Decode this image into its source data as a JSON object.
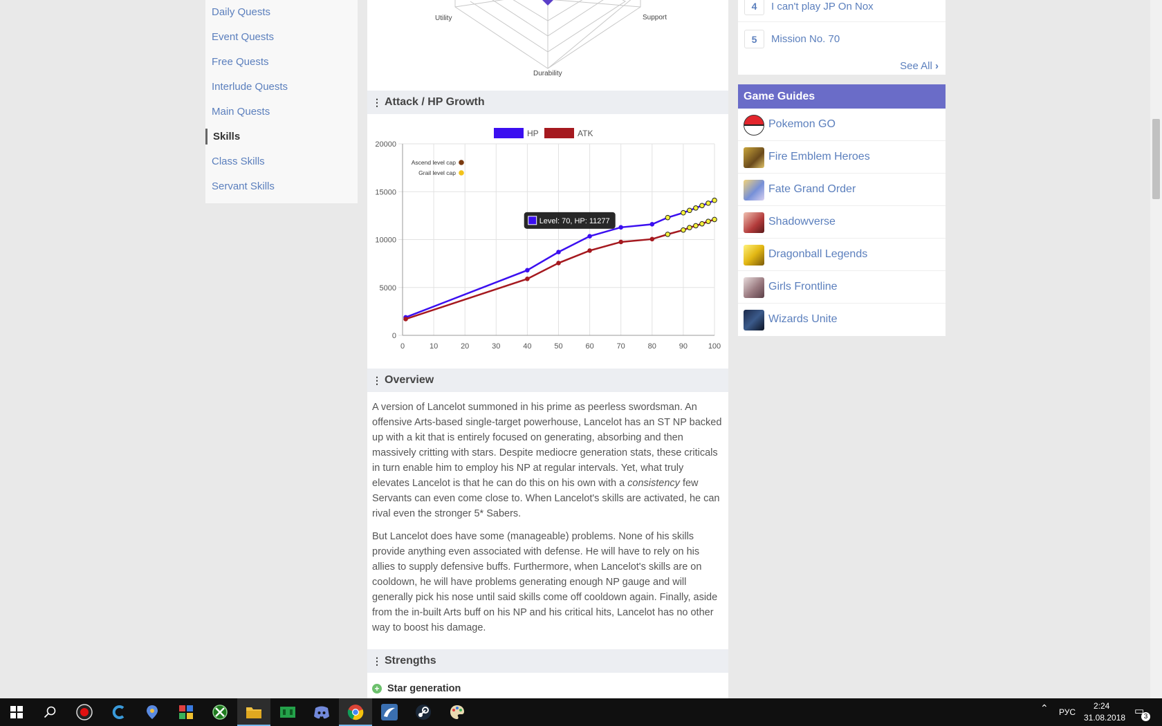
{
  "leftnav": {
    "items": [
      "Daily Quests",
      "Event Quests",
      "Free Quests",
      "Interlude Quests",
      "Main Quests",
      "Skills",
      "Class Skills",
      "Servant Skills"
    ],
    "active": "Skills"
  },
  "radar": {
    "labels": {
      "left": "Utility",
      "right": "Support",
      "bottom": "Durability"
    }
  },
  "growth": {
    "header": "Attack / HP Growth",
    "tooltip": "Level: 70, HP: 11277"
  },
  "chart_data": {
    "type": "line",
    "x": [
      1,
      40,
      50,
      60,
      70,
      80,
      85,
      90,
      92,
      94,
      96,
      98,
      100
    ],
    "series": [
      {
        "name": "HP",
        "color": "#3b0ff0",
        "values": [
          1880,
          6800,
          8700,
          10350,
          11277,
          11600,
          12300,
          12800,
          13050,
          13300,
          13550,
          13800,
          14100
        ]
      },
      {
        "name": "ATK",
        "color": "#a5191f",
        "values": [
          1700,
          5900,
          7550,
          8850,
          9750,
          10050,
          10550,
          11000,
          11250,
          11450,
          11650,
          11900,
          12100
        ]
      }
    ],
    "grail_from_index": 6,
    "xlim": [
      0,
      100
    ],
    "ylim": [
      0,
      20000
    ],
    "xticks": [
      "0",
      "10",
      "20",
      "30",
      "40",
      "50",
      "60",
      "70",
      "80",
      "90",
      "100"
    ],
    "yticks": [
      "0",
      "5000",
      "10000",
      "15000",
      "20000"
    ],
    "annotations": [
      "Ascend level cap",
      "Grail level cap"
    ],
    "legend": "top"
  },
  "overview": {
    "header": "Overview",
    "p1_before": "A version of Lancelot summoned in his prime as peerless swordsman. An offensive Arts-based single-target powerhouse, Lancelot has an ST NP backed up with a kit that is entirely focused on generating, absorbing and then massively critting with stars. Despite mediocre generation stats, these criticals in turn enable him to employ his NP at regular intervals. Yet, what truly elevates Lancelot is that he can do this on his own with a ",
    "p1_em": "consistency",
    "p1_after": " few Servants can even come close to. When Lancelot's skills are activated, he can rival even the stronger 5* Sabers.",
    "p2": "But Lancelot does have some (manageable) problems. None of his skills provide anything even associated with defense. He will have to rely on his allies to supply defensive buffs. Furthermore, when Lancelot's skills are on cooldown, he will have problems generating enough NP gauge and will generally pick his nose until said skills come off cooldown again. Finally, aside from the in-built Arts buff on his NP and his critical hits, Lancelot has no other way to boost his damage."
  },
  "strengths": {
    "header": "Strengths",
    "item1": "Star generation"
  },
  "top_list": {
    "rows": [
      {
        "num": "4",
        "text": "I can't play JP On Nox"
      },
      {
        "num": "5",
        "text": "Mission No. 70"
      }
    ],
    "see_all": "See All"
  },
  "guides": {
    "header": "Game Guides",
    "items": [
      "Pokemon GO",
      "Fire Emblem Heroes",
      "Fate Grand Order",
      "Shadowverse",
      "Dragonball Legends",
      "Girls Frontline",
      "Wizards Unite"
    ]
  },
  "tray": {
    "lang": "РУС",
    "time": "2:24",
    "date": "31.08.2018",
    "notifications": "3"
  }
}
